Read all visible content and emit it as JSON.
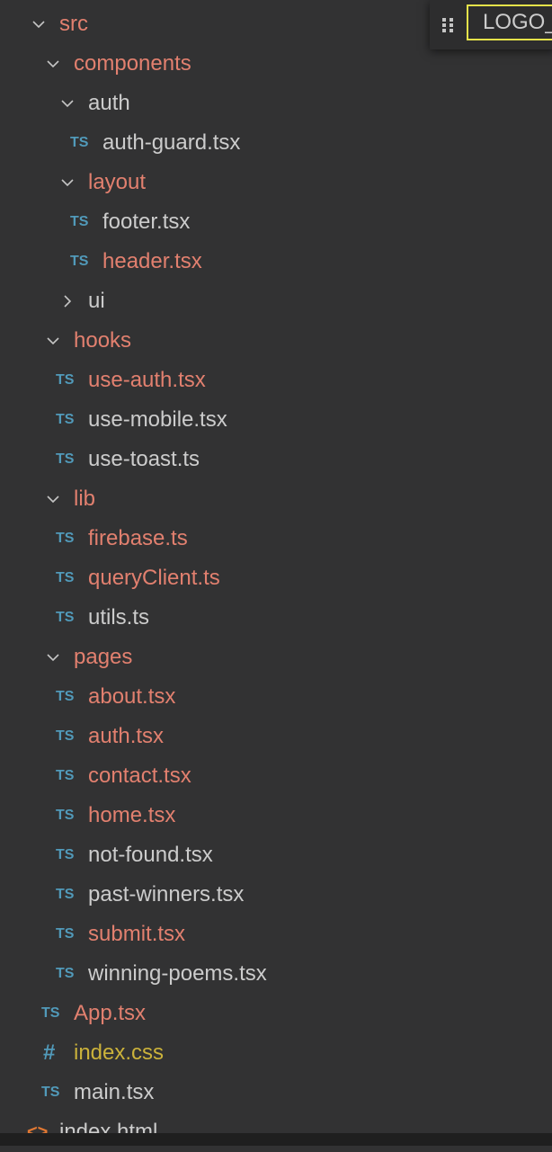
{
  "tree": [
    {
      "label": "src",
      "type": "folder",
      "open": true,
      "depth": 0,
      "status": "modified"
    },
    {
      "label": "components",
      "type": "folder",
      "open": true,
      "depth": 1,
      "status": "modified"
    },
    {
      "label": "auth",
      "type": "folder",
      "open": true,
      "depth": 2,
      "status": ""
    },
    {
      "label": "auth-guard.tsx",
      "type": "ts",
      "depth": 3,
      "status": ""
    },
    {
      "label": "layout",
      "type": "folder",
      "open": true,
      "depth": 2,
      "status": "modified"
    },
    {
      "label": "footer.tsx",
      "type": "ts",
      "depth": 3,
      "status": ""
    },
    {
      "label": "header.tsx",
      "type": "ts",
      "depth": 3,
      "status": "modified"
    },
    {
      "label": "ui",
      "type": "folder",
      "open": false,
      "depth": 2,
      "status": ""
    },
    {
      "label": "hooks",
      "type": "folder",
      "open": true,
      "depth": 1,
      "status": "modified"
    },
    {
      "label": "use-auth.tsx",
      "type": "ts",
      "depth": 2,
      "status": "modified"
    },
    {
      "label": "use-mobile.tsx",
      "type": "ts",
      "depth": 2,
      "status": ""
    },
    {
      "label": "use-toast.ts",
      "type": "ts",
      "depth": 2,
      "status": ""
    },
    {
      "label": "lib",
      "type": "folder",
      "open": true,
      "depth": 1,
      "status": "modified"
    },
    {
      "label": "firebase.ts",
      "type": "ts",
      "depth": 2,
      "status": "modified"
    },
    {
      "label": "queryClient.ts",
      "type": "ts",
      "depth": 2,
      "status": "modified"
    },
    {
      "label": "utils.ts",
      "type": "ts",
      "depth": 2,
      "status": ""
    },
    {
      "label": "pages",
      "type": "folder",
      "open": true,
      "depth": 1,
      "status": "modified"
    },
    {
      "label": "about.tsx",
      "type": "ts",
      "depth": 2,
      "status": "modified"
    },
    {
      "label": "auth.tsx",
      "type": "ts",
      "depth": 2,
      "status": "modified"
    },
    {
      "label": "contact.tsx",
      "type": "ts",
      "depth": 2,
      "status": "modified"
    },
    {
      "label": "home.tsx",
      "type": "ts",
      "depth": 2,
      "status": "modified"
    },
    {
      "label": "not-found.tsx",
      "type": "ts",
      "depth": 2,
      "status": ""
    },
    {
      "label": "past-winners.tsx",
      "type": "ts",
      "depth": 2,
      "status": ""
    },
    {
      "label": "submit.tsx",
      "type": "ts",
      "depth": 2,
      "status": "modified"
    },
    {
      "label": "winning-poems.tsx",
      "type": "ts",
      "depth": 2,
      "status": ""
    },
    {
      "label": "App.tsx",
      "type": "ts",
      "depth": 1,
      "status": "modified"
    },
    {
      "label": "index.css",
      "type": "css",
      "depth": 1,
      "status": "warning"
    },
    {
      "label": "main.tsx",
      "type": "ts",
      "depth": 1,
      "status": ""
    },
    {
      "label": "index.html",
      "type": "html",
      "depth": 0,
      "status": ""
    }
  ],
  "icons": {
    "ts": "TS",
    "css": "#",
    "html": "<>"
  },
  "find_widget": {
    "value": "LOGO_"
  },
  "colors": {
    "modified": "#e2806f",
    "warning": "#cbb23b",
    "ts_icon": "#519aba",
    "html_icon": "#e37933"
  }
}
